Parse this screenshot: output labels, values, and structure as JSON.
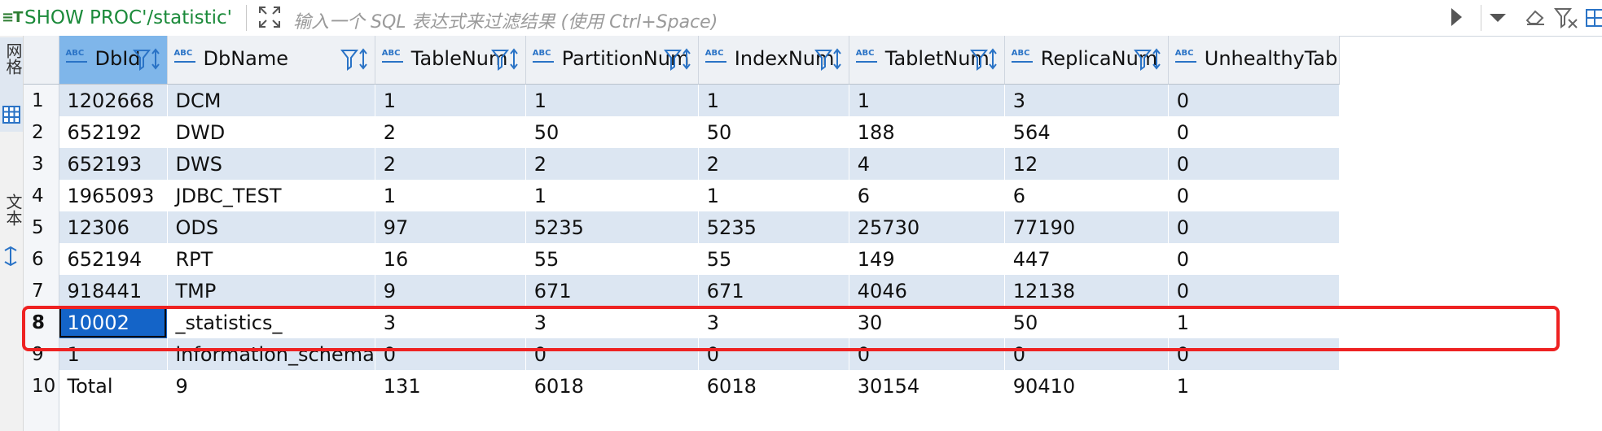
{
  "filter_bar": {
    "query_icon": "sql-icon",
    "query": "SHOW PROC'/statistic'",
    "placeholder": "输入一个 SQL 表达式来过滤结果 (使用 Ctrl+Space)"
  },
  "side_tabs": {
    "grid_label": "网格",
    "text_label": "文本"
  },
  "table": {
    "columns": [
      {
        "label": "DbId",
        "type_icon": "ABC"
      },
      {
        "label": "DbName",
        "type_icon": "ABC"
      },
      {
        "label": "TableNum",
        "type_icon": "ABC"
      },
      {
        "label": "PartitionNum",
        "type_icon": "ABC"
      },
      {
        "label": "IndexNum",
        "type_icon": "ABC"
      },
      {
        "label": "TabletNum",
        "type_icon": "ABC"
      },
      {
        "label": "ReplicaNum",
        "type_icon": "ABC"
      },
      {
        "label": "UnhealthyTable",
        "type_icon": "ABC"
      }
    ],
    "rows": [
      {
        "num": "1",
        "cells": [
          "1202668",
          "DCM",
          "1",
          "1",
          "1",
          "1",
          "3",
          "0"
        ]
      },
      {
        "num": "2",
        "cells": [
          "652192",
          "DWD",
          "2",
          "50",
          "50",
          "188",
          "564",
          "0"
        ]
      },
      {
        "num": "3",
        "cells": [
          "652193",
          "DWS",
          "2",
          "2",
          "2",
          "4",
          "12",
          "0"
        ]
      },
      {
        "num": "4",
        "cells": [
          "1965093",
          "JDBC_TEST",
          "1",
          "1",
          "1",
          "6",
          "6",
          "0"
        ]
      },
      {
        "num": "5",
        "cells": [
          "12306",
          "ODS",
          "97",
          "5235",
          "5235",
          "25730",
          "77190",
          "0"
        ]
      },
      {
        "num": "6",
        "cells": [
          "652194",
          "RPT",
          "16",
          "55",
          "55",
          "149",
          "447",
          "0"
        ]
      },
      {
        "num": "7",
        "cells": [
          "918441",
          "TMP",
          "9",
          "671",
          "671",
          "4046",
          "12138",
          "0"
        ]
      },
      {
        "num": "8",
        "cells": [
          "10002",
          "_statistics_",
          "3",
          "3",
          "3",
          "30",
          "50",
          "1"
        ]
      },
      {
        "num": "9",
        "cells": [
          "1",
          "information_schema",
          "0",
          "0",
          "0",
          "0",
          "0",
          "0"
        ]
      },
      {
        "num": "10",
        "cells": [
          "Total",
          "9",
          "131",
          "6018",
          "6018",
          "30154",
          "90410",
          "1"
        ]
      }
    ],
    "selected_row": "8",
    "accent_color": "#1464c8",
    "highlight_color": "#ee2222"
  }
}
